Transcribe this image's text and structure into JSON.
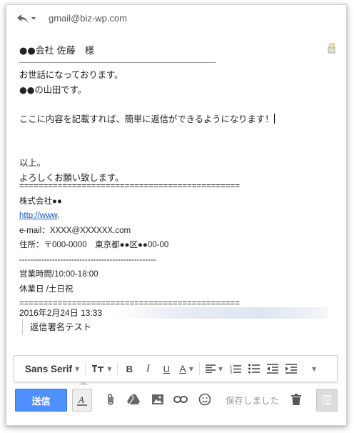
{
  "header": {
    "recipient": "gmail@biz-wp.com"
  },
  "to_line": "●●会社 佐藤　様",
  "body": {
    "lines": [
      "お世話になっております。",
      "●●の山田です。",
      "",
      "ここに内容を記載すれば、簡単に返信ができるようになります！",
      "",
      "",
      "以上。",
      "よろしくお願い致します。"
    ]
  },
  "signature": {
    "rule_top": "==============================================",
    "company": "株式会社●●",
    "url": "http://www",
    "url_suffix": ".",
    "email": "e-mail：XXXX@XXXXXX.com",
    "address": "住所：〒000-0000　東京都●●区●●00-00",
    "rule_mid": "--------------------------------------------------",
    "hours": "営業時間/10:00-18:00",
    "holidays": "休業日 /土日祝",
    "rule_bottom": "=============================================="
  },
  "quote": {
    "header": "2016年2月24日 13:33",
    "text": "返信署名テスト"
  },
  "toolbar": {
    "font_name": "Sans Serif"
  },
  "bottom": {
    "send_label": "送信",
    "saved_label": "保存しました"
  },
  "colors": {
    "send_blue": "#4d90fe",
    "link_blue": "#1155cc"
  }
}
